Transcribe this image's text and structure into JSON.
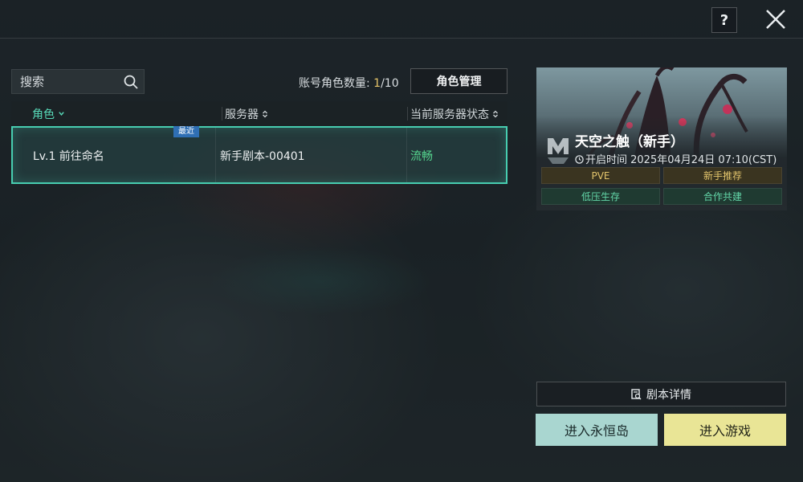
{
  "header": {
    "help_label": "?"
  },
  "search": {
    "placeholder": "搜索"
  },
  "account": {
    "count_label": "账号角色数量: ",
    "count_current": "1",
    "count_total": "/10",
    "manage_button": "角色管理"
  },
  "table": {
    "headers": [
      "角色",
      "服务器",
      "当前服务器状态"
    ],
    "rows": [
      {
        "badge": "最近",
        "role": "Lv.1 前往命名",
        "server": "新手剧本-00401",
        "status": "流畅"
      }
    ]
  },
  "scenario_card": {
    "title": "天空之触（新手）",
    "open_time": "开启时间 2025年04月24日 07:10(CST)",
    "tags": [
      "PVE",
      "新手推荐",
      "低压生存",
      "合作共建"
    ]
  },
  "actions": {
    "details": "剧本详情",
    "enter_island": "进入永恒岛",
    "enter_game": "进入游戏"
  },
  "colors": {
    "accent_teal": "#47cdb0",
    "status_smooth": "#56d68f",
    "count_highlight": "#e8c66a",
    "enter_game_bg": "#e9e596",
    "enter_island_bg": "#a9d6d0"
  }
}
